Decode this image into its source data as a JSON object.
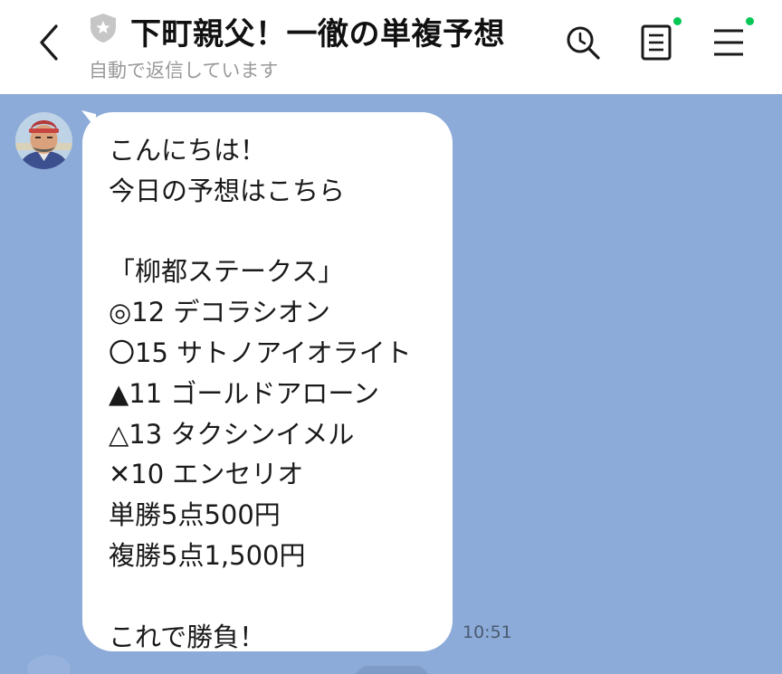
{
  "header": {
    "title": "下町親父！一徹の単複予想",
    "subtitle": "自動で返信しています"
  },
  "colors": {
    "chat_background": "#8dabd8",
    "header_background": "#ffffff",
    "bubble_background": "#ffffff",
    "notification_dot": "#06c755",
    "subtitle_text": "#9a9a9a"
  },
  "icons": {
    "back": "chevron-left-icon",
    "account_badge": "shield-star-icon",
    "search": "search-icon",
    "notes": "notes-icon",
    "menu": "menu-icon"
  },
  "message": {
    "lines": [
      "こんにちは！",
      "今日の予想はこちら",
      "",
      "「柳都ステークス」",
      "◎12 デコラシオン",
      "〇15 サトノアイオライト",
      "▲11 ゴールドアローン",
      "△13 タクシンイメル",
      "✕10 エンセリオ",
      "単勝5点500円",
      "複勝5点1,500円",
      "",
      "これで勝負！"
    ],
    "time": "10:51"
  }
}
